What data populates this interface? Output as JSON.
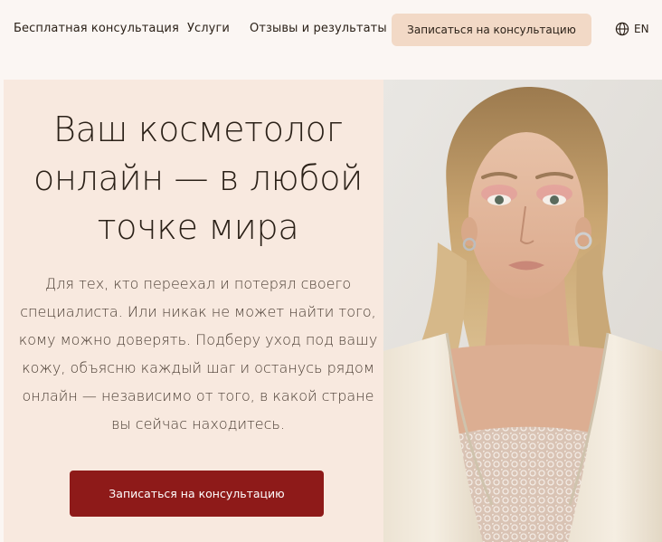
{
  "nav": {
    "free_consultation": "Бесплатная консультация",
    "services": "Услуги",
    "reviews": "Отзывы и результаты",
    "cta": "Записаться на консультацию",
    "lang": "EN",
    "lang_icon": "globe-icon"
  },
  "hero": {
    "title_line1": "Ваш косметолог",
    "title_line2": "онлайн — в любой",
    "title_line3": "точке мира",
    "text_line1": "Для тех, кто переехал и потерял своего",
    "text_line2": "специалиста. Или никак не может найти того,",
    "text_line3": "кому можно доверять. Подберу уход под вашу",
    "text_line4": "кожу, объясню каждый шаг и останусь рядом",
    "text_line5": "онлайн — независимо от того, в какой стране",
    "text_line6": "вы сейчас находитесь.",
    "cta": "Записаться на консультацию"
  },
  "colors": {
    "page_bg": "#fbf6f3",
    "hero_bg": "#f8e9df",
    "nav_cta_bg": "#f2d9c6",
    "primary_cta_bg": "#8e1a19",
    "text": "#2b2118"
  }
}
